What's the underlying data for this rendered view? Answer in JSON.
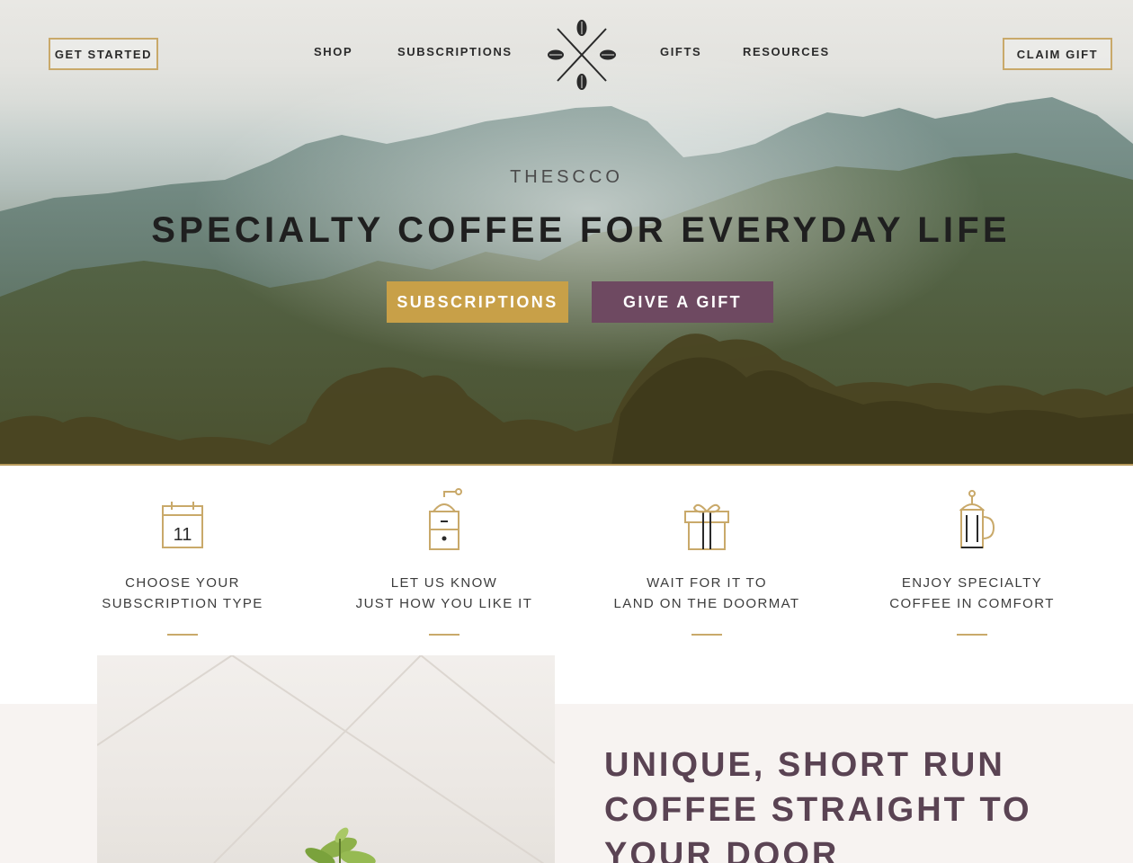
{
  "nav": {
    "get_started": "GET STARTED",
    "links_left": [
      "SHOP",
      "SUBSCRIPTIONS"
    ],
    "links_right": [
      "GIFTS",
      "RESOURCES"
    ],
    "claim_gift": "CLAIM GIFT",
    "logo_icon": "crossed-coffee-beans-logo-icon"
  },
  "hero": {
    "brand": "THESCCO",
    "headline": "SPECIALTY COFFEE FOR EVERYDAY LIFE",
    "cta_primary": "SUBSCRIPTIONS",
    "cta_secondary": "GIVE A GIFT"
  },
  "steps": [
    {
      "icon": "calendar-icon",
      "day": "11",
      "line1": "CHOOSE YOUR",
      "line2": "SUBSCRIPTION TYPE"
    },
    {
      "icon": "coffee-grinder-icon",
      "line1": "LET US KNOW",
      "line2": "JUST HOW YOU LIKE IT"
    },
    {
      "icon": "gift-box-icon",
      "line1": "WAIT FOR IT TO",
      "line2": "LAND ON THE DOORMAT"
    },
    {
      "icon": "french-press-icon",
      "line1": "ENJOY SPECIALTY",
      "line2": "COFFEE IN COMFORT"
    }
  ],
  "feature": {
    "title_line1": "UNIQUE, SHORT RUN",
    "title_line2": "COFFEE STRAIGHT TO",
    "title_line3": "YOUR DOOR"
  },
  "colors": {
    "gold": "#c8a048",
    "plum": "#6e4961",
    "heading_plum": "#5a4353",
    "outline_gold": "#c9a96a"
  }
}
